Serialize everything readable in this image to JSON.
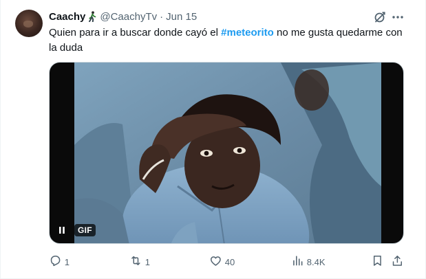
{
  "tweet": {
    "author": {
      "display_name": "Caachy",
      "emoji": "🚶",
      "handle": "@CaachyTv",
      "separator": "·",
      "date": "Jun 15"
    },
    "text_before": "Quien para ir a buscar donde cayó el ",
    "hashtag": "#meteorito",
    "text_after": " no me gusta quedarme con la duda",
    "media": {
      "type": "gif",
      "badge": "GIF",
      "control_icon": "pause-icon"
    },
    "actions": {
      "reply_count": "1",
      "retweet_count": "1",
      "like_count": "40",
      "views_count": "8.4K"
    }
  },
  "icons": {
    "grok": "grok-slash-circle-icon",
    "more": "more-horizontal-icon",
    "reply": "reply-icon",
    "retweet": "retweet-icon",
    "like": "heart-icon",
    "views": "views-bar-chart-icon",
    "bookmark": "bookmark-icon",
    "share": "share-icon"
  },
  "colors": {
    "accent": "#1d9bf0",
    "text": "#0f1419",
    "muted": "#536471",
    "border": "#cfd9de"
  }
}
